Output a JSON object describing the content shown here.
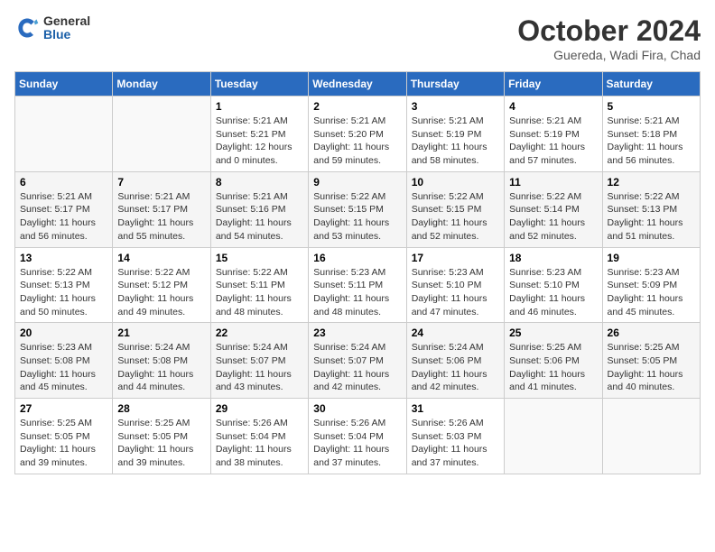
{
  "logo": {
    "general": "General",
    "blue": "Blue"
  },
  "title": "October 2024",
  "subtitle": "Guereda, Wadi Fira, Chad",
  "days_of_week": [
    "Sunday",
    "Monday",
    "Tuesday",
    "Wednesday",
    "Thursday",
    "Friday",
    "Saturday"
  ],
  "weeks": [
    [
      {
        "day": "",
        "sunrise": "",
        "sunset": "",
        "daylight": ""
      },
      {
        "day": "",
        "sunrise": "",
        "sunset": "",
        "daylight": ""
      },
      {
        "day": "1",
        "sunrise": "Sunrise: 5:21 AM",
        "sunset": "Sunset: 5:21 PM",
        "daylight": "Daylight: 12 hours and 0 minutes."
      },
      {
        "day": "2",
        "sunrise": "Sunrise: 5:21 AM",
        "sunset": "Sunset: 5:20 PM",
        "daylight": "Daylight: 11 hours and 59 minutes."
      },
      {
        "day": "3",
        "sunrise": "Sunrise: 5:21 AM",
        "sunset": "Sunset: 5:19 PM",
        "daylight": "Daylight: 11 hours and 58 minutes."
      },
      {
        "day": "4",
        "sunrise": "Sunrise: 5:21 AM",
        "sunset": "Sunset: 5:19 PM",
        "daylight": "Daylight: 11 hours and 57 minutes."
      },
      {
        "day": "5",
        "sunrise": "Sunrise: 5:21 AM",
        "sunset": "Sunset: 5:18 PM",
        "daylight": "Daylight: 11 hours and 56 minutes."
      }
    ],
    [
      {
        "day": "6",
        "sunrise": "Sunrise: 5:21 AM",
        "sunset": "Sunset: 5:17 PM",
        "daylight": "Daylight: 11 hours and 56 minutes."
      },
      {
        "day": "7",
        "sunrise": "Sunrise: 5:21 AM",
        "sunset": "Sunset: 5:17 PM",
        "daylight": "Daylight: 11 hours and 55 minutes."
      },
      {
        "day": "8",
        "sunrise": "Sunrise: 5:21 AM",
        "sunset": "Sunset: 5:16 PM",
        "daylight": "Daylight: 11 hours and 54 minutes."
      },
      {
        "day": "9",
        "sunrise": "Sunrise: 5:22 AM",
        "sunset": "Sunset: 5:15 PM",
        "daylight": "Daylight: 11 hours and 53 minutes."
      },
      {
        "day": "10",
        "sunrise": "Sunrise: 5:22 AM",
        "sunset": "Sunset: 5:15 PM",
        "daylight": "Daylight: 11 hours and 52 minutes."
      },
      {
        "day": "11",
        "sunrise": "Sunrise: 5:22 AM",
        "sunset": "Sunset: 5:14 PM",
        "daylight": "Daylight: 11 hours and 52 minutes."
      },
      {
        "day": "12",
        "sunrise": "Sunrise: 5:22 AM",
        "sunset": "Sunset: 5:13 PM",
        "daylight": "Daylight: 11 hours and 51 minutes."
      }
    ],
    [
      {
        "day": "13",
        "sunrise": "Sunrise: 5:22 AM",
        "sunset": "Sunset: 5:13 PM",
        "daylight": "Daylight: 11 hours and 50 minutes."
      },
      {
        "day": "14",
        "sunrise": "Sunrise: 5:22 AM",
        "sunset": "Sunset: 5:12 PM",
        "daylight": "Daylight: 11 hours and 49 minutes."
      },
      {
        "day": "15",
        "sunrise": "Sunrise: 5:22 AM",
        "sunset": "Sunset: 5:11 PM",
        "daylight": "Daylight: 11 hours and 48 minutes."
      },
      {
        "day": "16",
        "sunrise": "Sunrise: 5:23 AM",
        "sunset": "Sunset: 5:11 PM",
        "daylight": "Daylight: 11 hours and 48 minutes."
      },
      {
        "day": "17",
        "sunrise": "Sunrise: 5:23 AM",
        "sunset": "Sunset: 5:10 PM",
        "daylight": "Daylight: 11 hours and 47 minutes."
      },
      {
        "day": "18",
        "sunrise": "Sunrise: 5:23 AM",
        "sunset": "Sunset: 5:10 PM",
        "daylight": "Daylight: 11 hours and 46 minutes."
      },
      {
        "day": "19",
        "sunrise": "Sunrise: 5:23 AM",
        "sunset": "Sunset: 5:09 PM",
        "daylight": "Daylight: 11 hours and 45 minutes."
      }
    ],
    [
      {
        "day": "20",
        "sunrise": "Sunrise: 5:23 AM",
        "sunset": "Sunset: 5:08 PM",
        "daylight": "Daylight: 11 hours and 45 minutes."
      },
      {
        "day": "21",
        "sunrise": "Sunrise: 5:24 AM",
        "sunset": "Sunset: 5:08 PM",
        "daylight": "Daylight: 11 hours and 44 minutes."
      },
      {
        "day": "22",
        "sunrise": "Sunrise: 5:24 AM",
        "sunset": "Sunset: 5:07 PM",
        "daylight": "Daylight: 11 hours and 43 minutes."
      },
      {
        "day": "23",
        "sunrise": "Sunrise: 5:24 AM",
        "sunset": "Sunset: 5:07 PM",
        "daylight": "Daylight: 11 hours and 42 minutes."
      },
      {
        "day": "24",
        "sunrise": "Sunrise: 5:24 AM",
        "sunset": "Sunset: 5:06 PM",
        "daylight": "Daylight: 11 hours and 42 minutes."
      },
      {
        "day": "25",
        "sunrise": "Sunrise: 5:25 AM",
        "sunset": "Sunset: 5:06 PM",
        "daylight": "Daylight: 11 hours and 41 minutes."
      },
      {
        "day": "26",
        "sunrise": "Sunrise: 5:25 AM",
        "sunset": "Sunset: 5:05 PM",
        "daylight": "Daylight: 11 hours and 40 minutes."
      }
    ],
    [
      {
        "day": "27",
        "sunrise": "Sunrise: 5:25 AM",
        "sunset": "Sunset: 5:05 PM",
        "daylight": "Daylight: 11 hours and 39 minutes."
      },
      {
        "day": "28",
        "sunrise": "Sunrise: 5:25 AM",
        "sunset": "Sunset: 5:05 PM",
        "daylight": "Daylight: 11 hours and 39 minutes."
      },
      {
        "day": "29",
        "sunrise": "Sunrise: 5:26 AM",
        "sunset": "Sunset: 5:04 PM",
        "daylight": "Daylight: 11 hours and 38 minutes."
      },
      {
        "day": "30",
        "sunrise": "Sunrise: 5:26 AM",
        "sunset": "Sunset: 5:04 PM",
        "daylight": "Daylight: 11 hours and 37 minutes."
      },
      {
        "day": "31",
        "sunrise": "Sunrise: 5:26 AM",
        "sunset": "Sunset: 5:03 PM",
        "daylight": "Daylight: 11 hours and 37 minutes."
      },
      {
        "day": "",
        "sunrise": "",
        "sunset": "",
        "daylight": ""
      },
      {
        "day": "",
        "sunrise": "",
        "sunset": "",
        "daylight": ""
      }
    ]
  ]
}
